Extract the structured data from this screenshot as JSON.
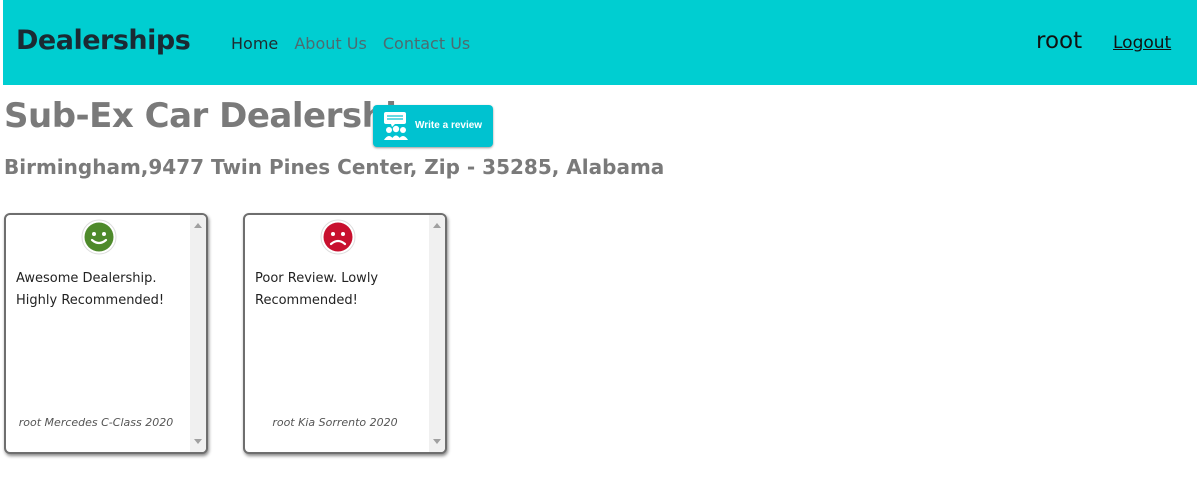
{
  "navbar": {
    "brand": "Dealerships",
    "links": [
      "Home",
      "About Us",
      "Contact Us"
    ],
    "username": "root",
    "logout": "Logout",
    "bg_color": "#00ced1"
  },
  "dealer": {
    "name": "Sub-Ex Car Dealership",
    "review_button": "Write a review",
    "address": "Birmingham,9477 Twin Pines Center, Zip - 35285, Alabama"
  },
  "reviews": [
    {
      "sentiment": "positive",
      "icon": "smiley-face-icon",
      "text": "Awesome Dealership. Highly Recommended!",
      "meta": "root Mercedes C-Class 2020",
      "icon_color": "#4e8a2b"
    },
    {
      "sentiment": "negative",
      "icon": "sad-face-icon",
      "text": "Poor Review. Lowly Recommended!",
      "meta": "root Kia Sorrento 2020",
      "icon_color": "#c8102e"
    }
  ]
}
